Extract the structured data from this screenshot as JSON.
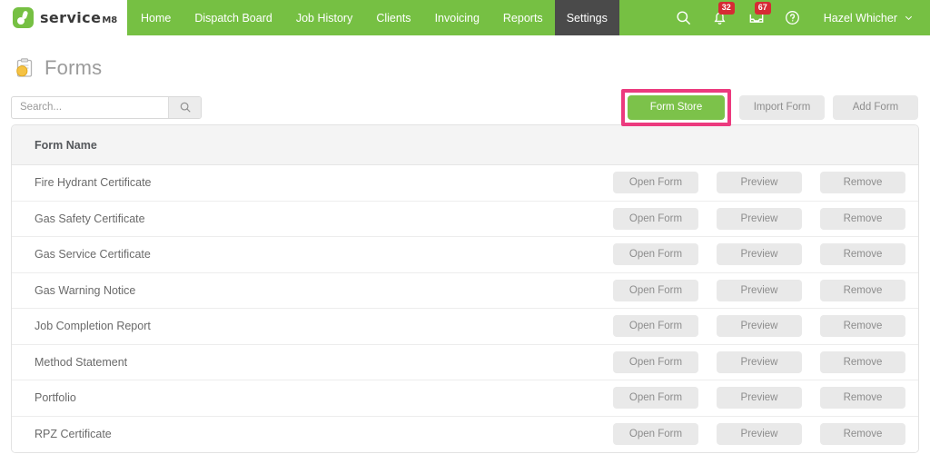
{
  "header": {
    "logo": {
      "name": "service",
      "suffix": "M8",
      "icon": "servicem8-logo-icon"
    },
    "nav": [
      {
        "label": "Home",
        "active": false
      },
      {
        "label": "Dispatch Board",
        "active": false
      },
      {
        "label": "Job History",
        "active": false
      },
      {
        "label": "Clients",
        "active": false
      },
      {
        "label": "Invoicing",
        "active": false
      },
      {
        "label": "Reports",
        "active": false
      },
      {
        "label": "Settings",
        "active": true
      }
    ],
    "icons": {
      "search": "search-icon",
      "notifications": "bell-icon",
      "inbox": "inbox-icon",
      "help": "help-icon",
      "chevron": "chevron-down-icon"
    },
    "badges": {
      "notifications": "32",
      "inbox": "67"
    },
    "user": {
      "name": "Hazel Whicher"
    }
  },
  "page": {
    "title": "Forms",
    "title_icon": "forms-clipboard-icon"
  },
  "search": {
    "placeholder": "Search...",
    "value": "",
    "button_icon": "search-icon"
  },
  "toolbar": {
    "form_store_label": "Form Store",
    "import_form_label": "Import Form",
    "add_form_label": "Add Form",
    "highlighted": "form-store-button"
  },
  "table": {
    "column_header": "Form Name",
    "action_labels": {
      "open": "Open Form",
      "preview": "Preview",
      "remove": "Remove"
    },
    "rows": [
      {
        "name": "Fire Hydrant Certificate"
      },
      {
        "name": "Gas Safety Certificate"
      },
      {
        "name": "Gas Service Certificate"
      },
      {
        "name": "Gas Warning Notice"
      },
      {
        "name": "Job Completion Report"
      },
      {
        "name": "Method Statement"
      },
      {
        "name": "Portfolio"
      },
      {
        "name": "RPZ Certificate"
      }
    ]
  },
  "colors": {
    "brand_green": "#76c043",
    "active_tab": "#4a4a4a",
    "badge_red": "#d62b34",
    "highlight_pink": "#ec3a7e",
    "button_green": "#7cc24a",
    "button_gray": "#e9e9e9"
  }
}
